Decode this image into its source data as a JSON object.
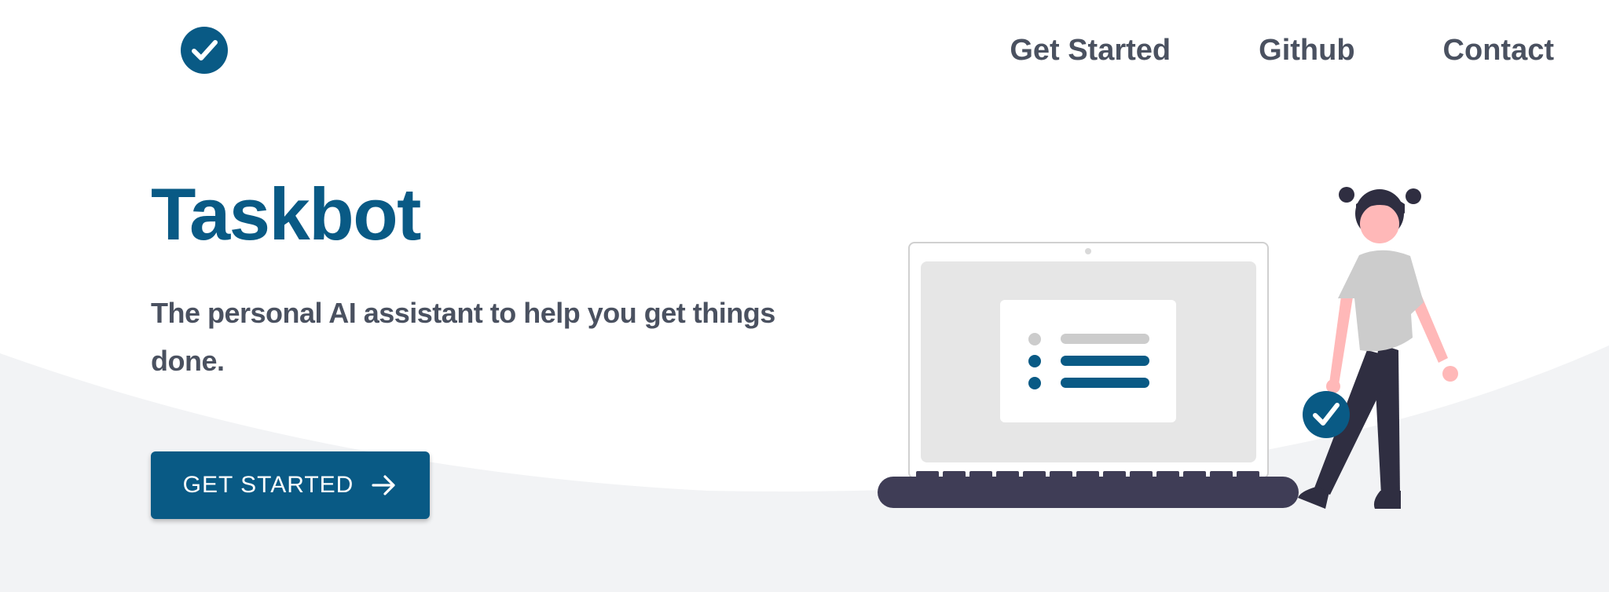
{
  "brand": {
    "logo_icon": "check-circle-icon",
    "accent_color": "#095a85"
  },
  "nav": {
    "items": [
      {
        "label": "Get Started"
      },
      {
        "label": "Github"
      },
      {
        "label": "Contact"
      }
    ]
  },
  "hero": {
    "title": "Taskbot",
    "subtitle": "The personal AI assistant to help you get things done.",
    "cta": {
      "label": "GET STARTED",
      "icon": "arrow-right-icon"
    }
  },
  "illustration": {
    "subject": "laptop-task-list-with-person-holding-check-badge"
  }
}
